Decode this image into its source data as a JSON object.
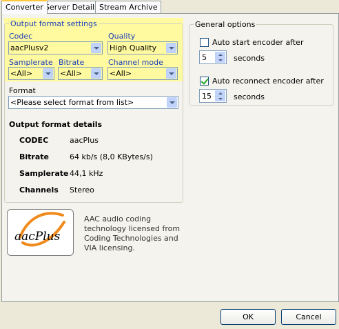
{
  "tabs": [
    "Converter",
    "Server Details",
    "Stream Archive"
  ],
  "output_settings": {
    "legend": "Output format settings",
    "codec_label": "Codec",
    "codec_value": "aacPlusv2",
    "quality_label": "Quality",
    "quality_value": "High Quality",
    "samplerate_label": "Samplerate",
    "samplerate_value": "<All>",
    "bitrate_label": "Bitrate",
    "bitrate_value": "<All>",
    "channel_mode_label": "Channel mode",
    "channel_mode_value": "<All>",
    "format_label": "Format",
    "format_value": "<Please select format from list>"
  },
  "details": {
    "title": "Output format details",
    "rows": [
      {
        "key": "CODEC",
        "value": "aacPlus"
      },
      {
        "key": "Bitrate",
        "value": "64 kb/s (8,0 KBytes/s)"
      },
      {
        "key": "Samplerate",
        "value": "44,1 kHz"
      },
      {
        "key": "Channels",
        "value": "Stereo"
      }
    ]
  },
  "general": {
    "legend": "General options",
    "auto_start_label": "Auto start encoder after",
    "auto_start_checked": false,
    "auto_start_seconds": "5",
    "auto_reconnect_label": "Auto reconnect encoder after",
    "auto_reconnect_checked": true,
    "auto_reconnect_seconds": "15",
    "seconds_label": "seconds"
  },
  "logo": {
    "text": "aacPlus"
  },
  "license": {
    "line1": "AAC audio coding",
    "line2": "technology licensed from",
    "line3": "Coding Technologies and",
    "line4": "VIA licensing."
  },
  "buttons": {
    "ok": "OK",
    "cancel": "Cancel"
  },
  "colors": {
    "highlight": "#fffaa0",
    "legend_blue": "#1c3fbb"
  }
}
